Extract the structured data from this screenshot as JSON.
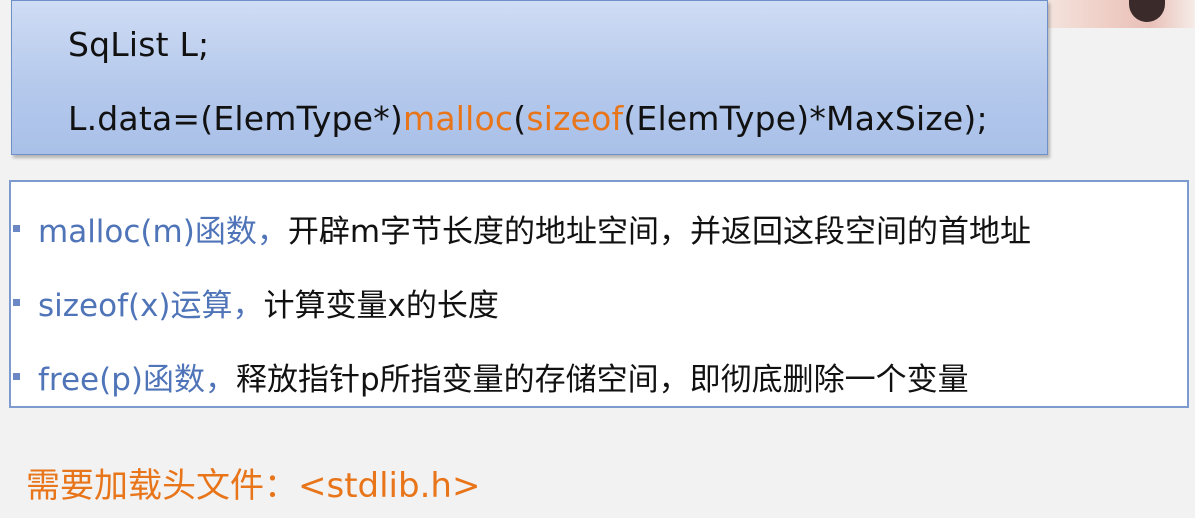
{
  "code_box": {
    "line1": "SqList L;",
    "line2": {
      "prefix": "L.data=(ElemType*)",
      "fn1": "malloc",
      "paren1": "(",
      "fn2": "sizeof",
      "suffix": "(ElemType)*MaxSize);"
    }
  },
  "notes": [
    {
      "term": "malloc(m)函数，",
      "desc": "开辟m字节长度的地址空间，并返回这段空间的首地址"
    },
    {
      "term": "sizeof(x)运算，",
      "desc": "计算变量x的长度"
    },
    {
      "term": "free(p)函数，",
      "desc": "释放指针p所指变量的存储空间，即彻底删除一个变量"
    }
  ],
  "footer": {
    "text": "需要加载头文件：<stdlib.h>"
  },
  "colors": {
    "keyword": "#e8751a",
    "term": "#4f74b8",
    "box_border": "#7e9bd0"
  }
}
